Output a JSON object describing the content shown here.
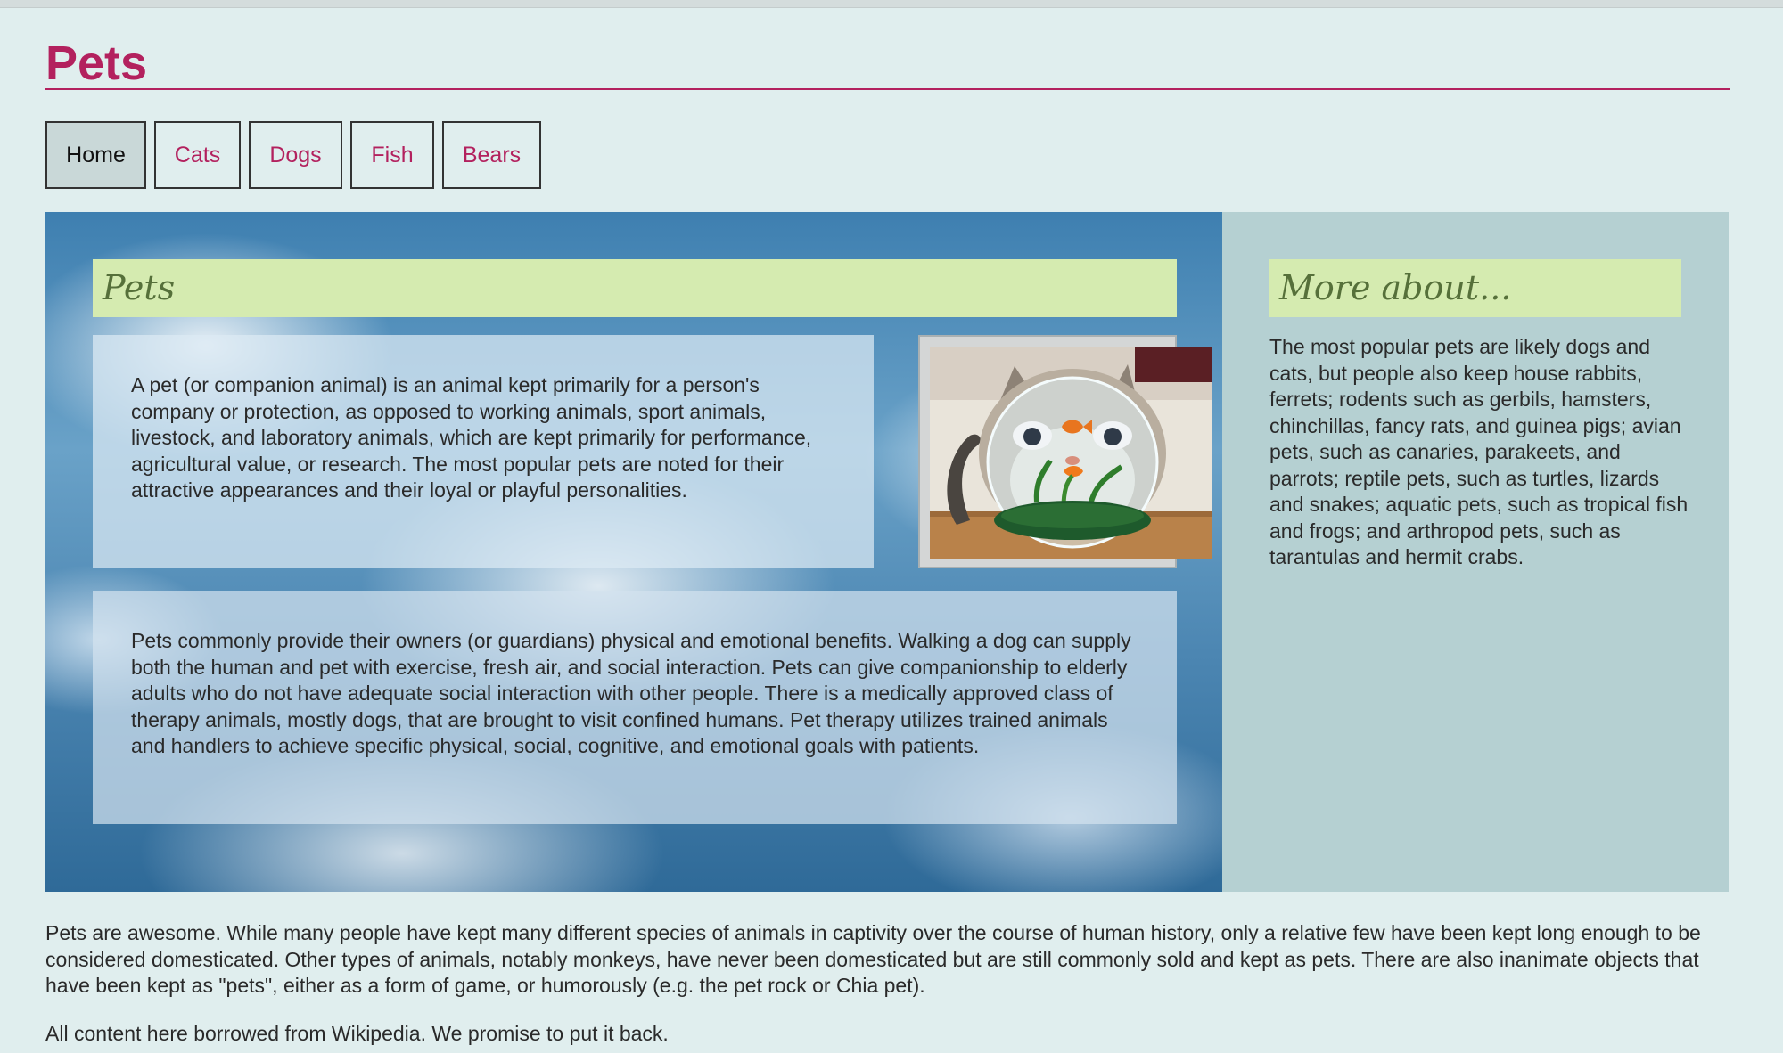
{
  "site": {
    "title": "Pets"
  },
  "nav": {
    "items": [
      {
        "label": "Home",
        "active": true
      },
      {
        "label": "Cats",
        "active": false
      },
      {
        "label": "Dogs",
        "active": false
      },
      {
        "label": "Fish",
        "active": false
      },
      {
        "label": "Bears",
        "active": false
      }
    ]
  },
  "main": {
    "heading": "Pets",
    "intro": "A pet (or companion animal) is an animal kept primarily for a person's company or protection, as opposed to working animals, sport animals, livestock, and laboratory animals, which are kept primarily for performance, agricultural value, or research. The most popular pets are noted for their attractive appearances and their loyal or playful personalities.",
    "benefits": "Pets commonly provide their owners (or guardians) physical and emotional benefits. Walking a dog can supply both the human and pet with exercise, fresh air, and social interaction. Pets can give companionship to elderly adults who do not have adequate social interaction with other people. There is a medically approved class of therapy animals, mostly dogs, that are brought to visit confined humans. Pet therapy utilizes trained animals and handlers to achieve specific physical, social, cognitive, and emotional goals with patients."
  },
  "aside": {
    "heading": "More about...",
    "text": "The most popular pets are likely dogs and cats, but people also keep house rabbits, ferrets; rodents such as gerbils, hamsters, chinchillas, fancy rats, and guinea pigs; avian pets, such as canaries, parakeets, and parrots; reptile pets, such as turtles, lizards and snakes; aquatic pets, such as tropical fish and frogs; and arthropod pets, such as tarantulas and hermit crabs."
  },
  "footer": {
    "paragraph": "Pets are awesome. While many people have kept many different species of animals in captivity over the course of human history, only a relative few have been kept long enough to be considered domesticated. Other types of animals, notably monkeys, have never been domesticated but are still commonly sold and kept as pets. There are also inanimate objects that have been kept as \"pets\", either as a form of game, or humorously (e.g. the pet rock or Chia pet).",
    "credit": "All content here borrowed from Wikipedia. We promise to put it back."
  },
  "colors": {
    "brand": "#b3215e",
    "heading_band": "#d5ebb0",
    "heading_text": "#56703a",
    "sidebar_bg": "#b5d0d2",
    "page_bg": "#e0eeee"
  }
}
